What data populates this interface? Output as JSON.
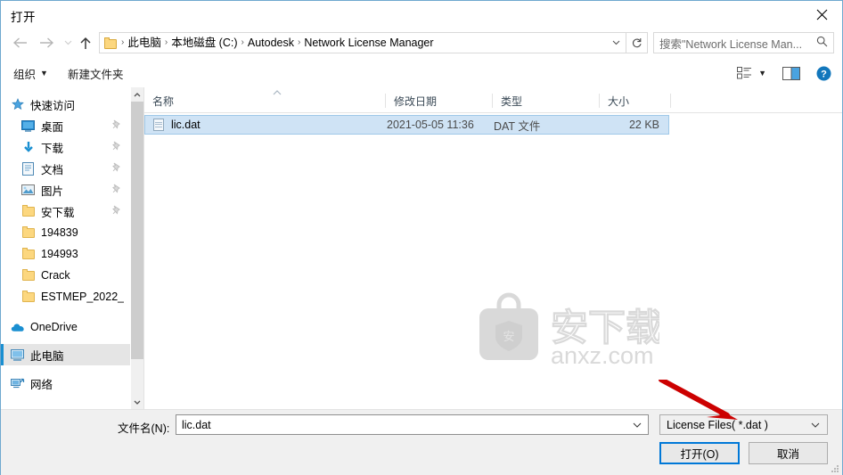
{
  "window": {
    "title": "打开",
    "close_icon": "close-icon"
  },
  "nav": {
    "back_icon": "back-arrow-icon",
    "forward_icon": "forward-arrow-icon",
    "recent_icon": "chevron-down-icon",
    "up_icon": "up-arrow-icon",
    "refresh_icon": "refresh-icon",
    "dropdown_icon": "chevron-down-icon"
  },
  "address": {
    "folder_icon": "folder-icon",
    "separator": "›",
    "crumbs": [
      "此电脑",
      "本地磁盘 (C:)",
      "Autodesk",
      "Network License Manager"
    ]
  },
  "search": {
    "text": "搜索\"Network License Man...",
    "icon": "search-icon"
  },
  "toolbar": {
    "organize_label": "组织",
    "new_folder_label": "新建文件夹",
    "caret": "▼",
    "view_icon": "view-options-icon",
    "preview_icon": "preview-pane-icon",
    "help_icon": "help-icon"
  },
  "sidebar": {
    "items": [
      {
        "label": "快速访问",
        "icon": "star-icon",
        "pinned": false,
        "selected": false,
        "root": true
      },
      {
        "label": "桌面",
        "icon": "desktop-icon",
        "pinned": true,
        "selected": false,
        "root": false
      },
      {
        "label": "下载",
        "icon": "download-icon",
        "pinned": true,
        "selected": false,
        "root": false
      },
      {
        "label": "文档",
        "icon": "documents-icon",
        "pinned": true,
        "selected": false,
        "root": false
      },
      {
        "label": "图片",
        "icon": "pictures-icon",
        "pinned": true,
        "selected": false,
        "root": false
      },
      {
        "label": "安下载",
        "icon": "folder-icon",
        "pinned": true,
        "selected": false,
        "root": false
      },
      {
        "label": "194839",
        "icon": "folder-icon",
        "pinned": false,
        "selected": false,
        "root": false
      },
      {
        "label": "194993",
        "icon": "folder-icon",
        "pinned": false,
        "selected": false,
        "root": false
      },
      {
        "label": "Crack",
        "icon": "folder-icon",
        "pinned": false,
        "selected": false,
        "root": false
      },
      {
        "label": "ESTMEP_2022_",
        "icon": "folder-icon",
        "pinned": false,
        "selected": false,
        "root": false
      },
      {
        "label": "OneDrive",
        "icon": "onedrive-icon",
        "pinned": false,
        "selected": false,
        "root": true
      },
      {
        "label": "此电脑",
        "icon": "this-pc-icon",
        "pinned": false,
        "selected": true,
        "root": true
      },
      {
        "label": "网络",
        "icon": "network-icon",
        "pinned": false,
        "selected": false,
        "root": true
      }
    ],
    "scroll_up_icon": "scroll-up-icon",
    "scroll_down_icon": "scroll-down-icon"
  },
  "filelist": {
    "columns": [
      "名称",
      "修改日期",
      "类型",
      "大小"
    ],
    "sort_indicator": "ascending",
    "rows": [
      {
        "name": "lic.dat",
        "date": "2021-05-05 11:36",
        "type": "DAT 文件",
        "size": "22 KB",
        "icon": "dat-file-icon",
        "selected": true
      }
    ]
  },
  "watermark": {
    "text_cn": "安下载",
    "text_en": "anxz.com",
    "badge": "安"
  },
  "footer": {
    "filename_label": "文件名(N):",
    "filename_value": "lic.dat",
    "filename_placeholder": "文件名",
    "filter_value": "License Files( *.dat )",
    "dropdown_icon": "chevron-down-icon",
    "open_button": "打开(O)",
    "cancel_button": "取消"
  },
  "annotation": {
    "type": "red-arrow",
    "color": "#cc0000",
    "points_to": "filter-dropdown"
  }
}
